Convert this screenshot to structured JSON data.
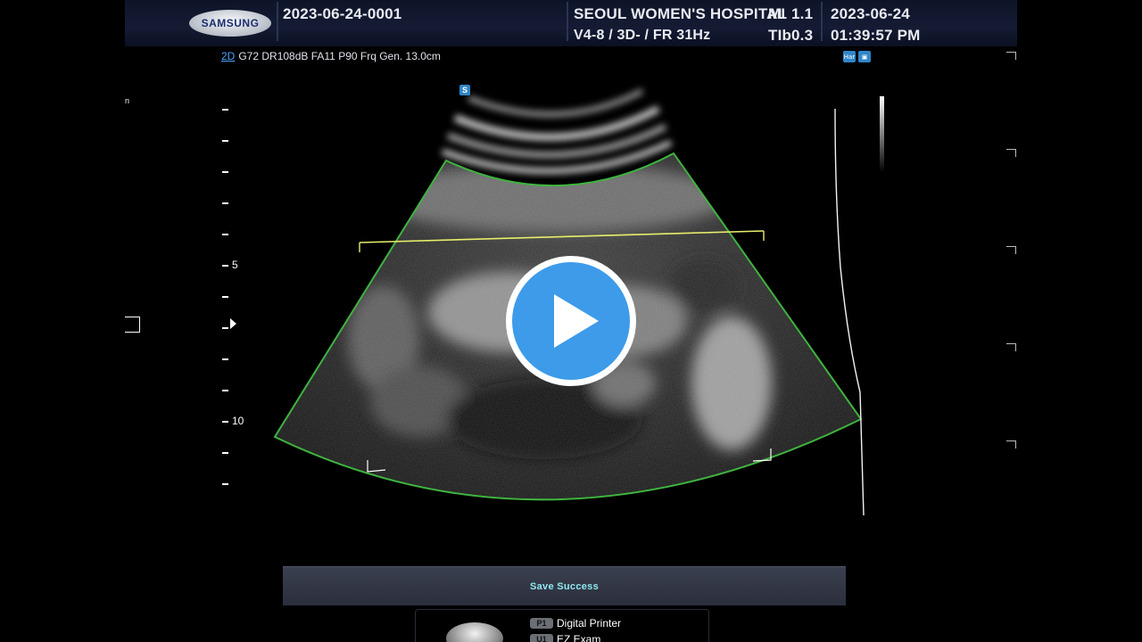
{
  "header": {
    "brand": "SAMSUNG",
    "patient_id": "2023-06-24-0001",
    "hospital": "SEOUL WOMEN'S HOSPITAL",
    "probe_info": "V4-8 / 3D- / FR 31Hz",
    "mi_label": "MI",
    "mi_value": "1.1",
    "tib_label": "TIb",
    "tib_value": "0.3",
    "date": "2023-06-24",
    "time": "01:39:57 PM"
  },
  "image_params": {
    "mode": "2D",
    "settings": "G72 DR108dB FA11 P90 Frq Gen. 13.0cm"
  },
  "icons": {
    "harmonic": "Har",
    "s_marker": "S"
  },
  "depth_scale": {
    "labels": [
      "5",
      "10"
    ]
  },
  "player": {
    "state": "paused"
  },
  "status": {
    "message": "Save Success"
  },
  "user_keys": [
    {
      "key": "P1",
      "label": "Digital Printer"
    },
    {
      "key": "U1",
      "label": "EZ Exam"
    }
  ],
  "colors": {
    "roi_line": "#3fb43f",
    "volume_line": "#e8ee6a",
    "play_blue": "#3d9be9",
    "status_text": "#8fe8ef",
    "mode_link": "#4da3ff"
  }
}
